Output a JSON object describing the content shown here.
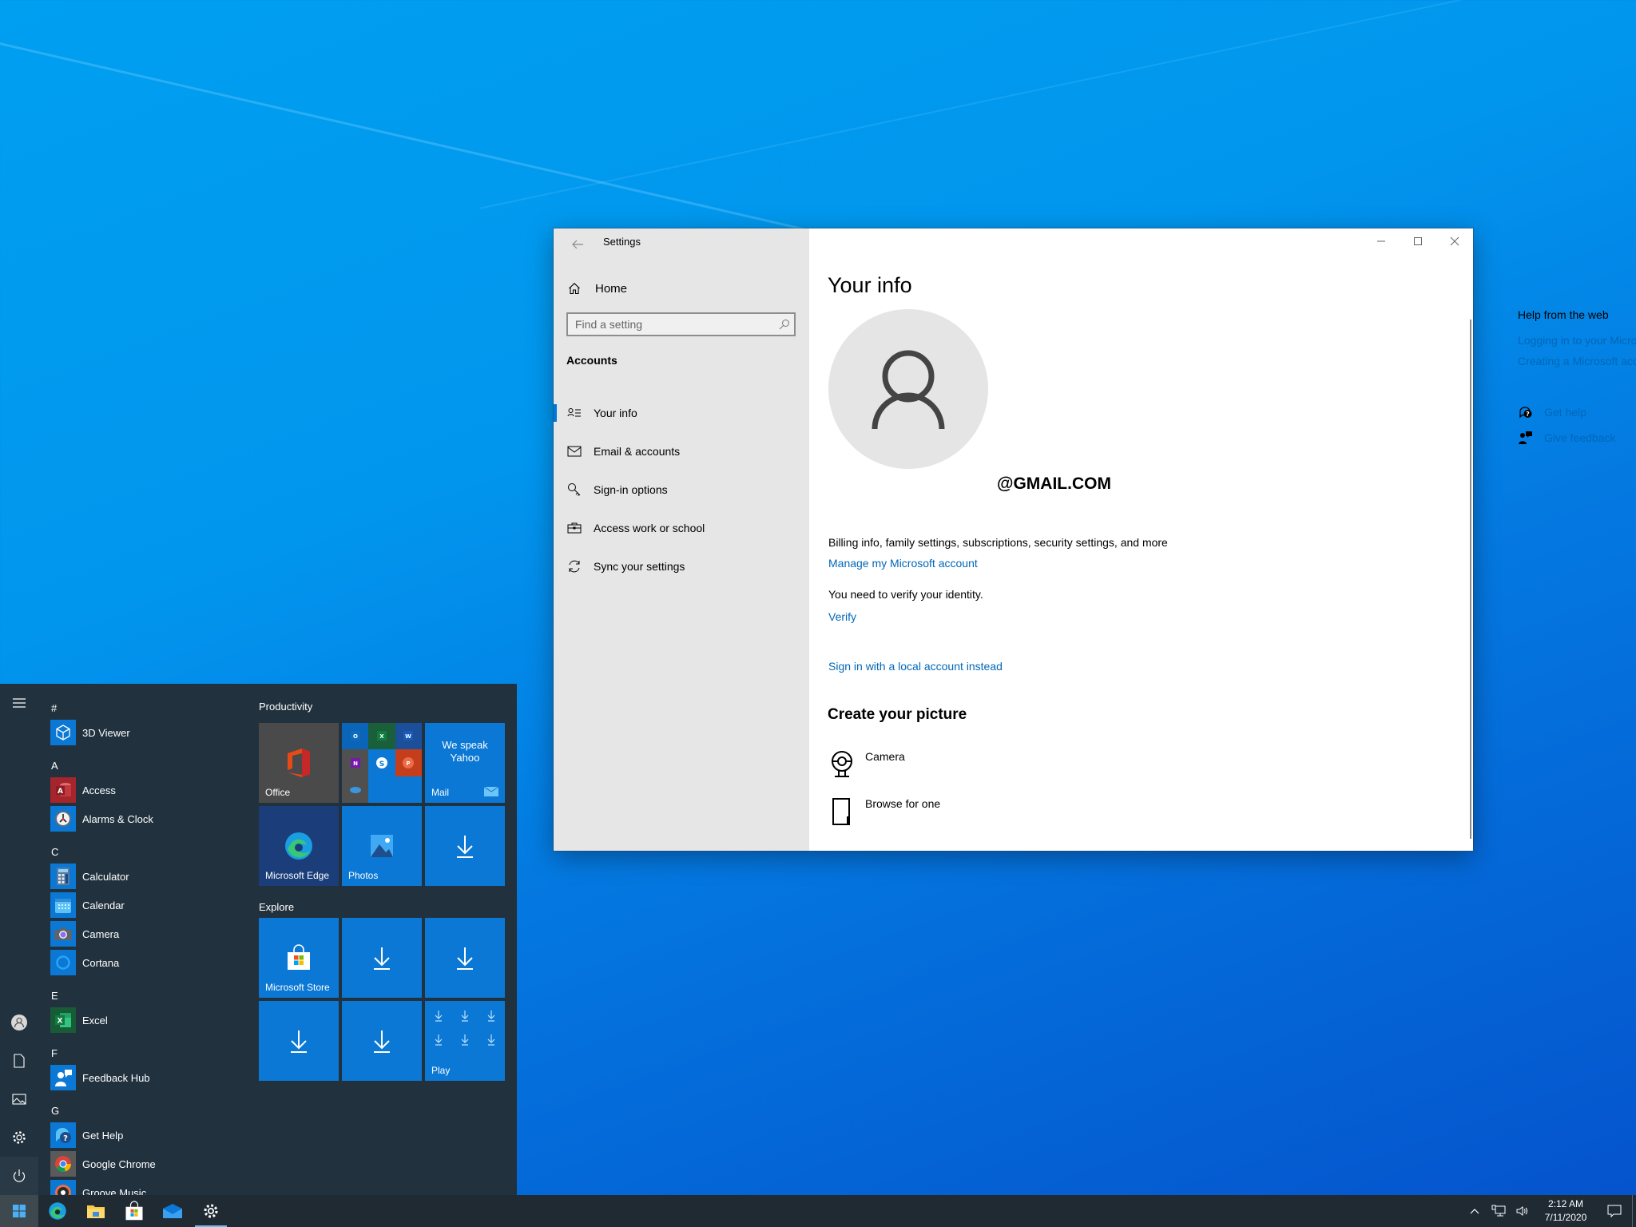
{
  "desktop": {
    "background_color": "#0196ee"
  },
  "settings_window": {
    "title": "Settings",
    "back_icon": "arrow-left-icon",
    "caption_buttons": {
      "minimize_icon": "minimize-icon",
      "maximize_icon": "maximize-icon",
      "close_icon": "close-icon"
    },
    "nav": {
      "home_label": "Home",
      "home_icon": "home-icon",
      "search": {
        "placeholder": "Find a setting",
        "value": "",
        "icon": "search-icon"
      },
      "section_title": "Accounts",
      "items": [
        {
          "label": "Your info",
          "icon": "person-list-icon",
          "active": true
        },
        {
          "label": "Email & accounts",
          "icon": "mail-icon",
          "active": false
        },
        {
          "label": "Sign-in options",
          "icon": "key-icon",
          "active": false
        },
        {
          "label": "Access work or school",
          "icon": "briefcase-icon",
          "active": false
        },
        {
          "label": "Sync your settings",
          "icon": "sync-icon",
          "active": false
        }
      ]
    },
    "content": {
      "title": "Your info",
      "avatar_icon": "person-icon",
      "email": "@GMAIL.COM",
      "billing_text": "Billing info, family settings, subscriptions, security settings, and more",
      "manage_link": "Manage my Microsoft account",
      "verify_text": "You need to verify your identity.",
      "verify_link": "Verify",
      "local_account_link": "Sign in with a local account instead",
      "create_picture_title": "Create your picture",
      "picture_options": [
        {
          "label": "Camera",
          "icon": "webcam-icon"
        },
        {
          "label": "Browse for one",
          "icon": "file-icon"
        }
      ]
    },
    "help": {
      "title": "Help from the web",
      "links": [
        "Logging in to your Microsoft account",
        "Creating a Microsoft account"
      ],
      "actions": [
        {
          "label": "Get help",
          "icon": "help-chat-icon"
        },
        {
          "label": "Give feedback",
          "icon": "feedback-icon"
        }
      ]
    },
    "accent_color": "#0078d7",
    "link_color": "#0067b8"
  },
  "start_menu": {
    "rail": [
      {
        "name": "hamburger-menu-icon"
      },
      {
        "name": "user-account-icon"
      },
      {
        "name": "documents-icon"
      },
      {
        "name": "pictures-icon"
      },
      {
        "name": "settings-gear-icon"
      },
      {
        "name": "power-icon"
      }
    ],
    "app_list": [
      {
        "letter": "#"
      },
      {
        "app": "3D Viewer",
        "icon": "cube-icon",
        "color": "#0a78d4"
      },
      {
        "letter": "A"
      },
      {
        "app": "Access",
        "icon": "access-icon",
        "color": "#a4262c"
      },
      {
        "app": "Alarms & Clock",
        "icon": "clock-icon",
        "color": "#0a78d4"
      },
      {
        "letter": "C"
      },
      {
        "app": "Calculator",
        "icon": "calculator-icon",
        "color": "#0a78d4"
      },
      {
        "app": "Calendar",
        "icon": "calendar-icon",
        "color": "#0a78d4"
      },
      {
        "app": "Camera",
        "icon": "camera-icon",
        "color": "#0a78d4"
      },
      {
        "app": "Cortana",
        "icon": "cortana-icon",
        "color": "#0a78d4"
      },
      {
        "letter": "E"
      },
      {
        "app": "Excel",
        "icon": "excel-icon",
        "color": "#107c41"
      },
      {
        "letter": "F"
      },
      {
        "app": "Feedback Hub",
        "icon": "feedback-hub-icon",
        "color": "#0a78d4"
      },
      {
        "letter": "G"
      },
      {
        "app": "Get Help",
        "icon": "get-help-icon",
        "color": "#0a78d4"
      },
      {
        "app": "Google Chrome",
        "icon": "chrome-icon",
        "color": "#5a5a5a"
      },
      {
        "app": "Groove Music",
        "icon": "groove-music-icon",
        "color": "#0a78d4"
      }
    ],
    "groups": [
      {
        "label": "Productivity",
        "tiles": [
          {
            "label": "Office",
            "icon": "office-icon",
            "color": "#4a4a4a"
          },
          {
            "label": "",
            "icon": "office-apps-folder-icon",
            "color": "#0a78d4"
          },
          {
            "label": "Mail",
            "icon": "mail-tile-icon",
            "text": "We speak Yahoo",
            "color": "#0a78d4"
          },
          {
            "label": "Microsoft Edge",
            "icon": "edge-icon",
            "color": "#1b3e7a"
          },
          {
            "label": "Photos",
            "icon": "photos-icon",
            "color": "#0a78d4"
          },
          {
            "label": "",
            "icon": "download-icon",
            "color": "#0a78d4"
          }
        ]
      },
      {
        "label": "Explore",
        "tiles": [
          {
            "label": "Microsoft Store",
            "icon": "store-icon",
            "color": "#0a78d4"
          },
          {
            "label": "",
            "icon": "download-icon",
            "color": "#0a78d4"
          },
          {
            "label": "",
            "icon": "download-icon",
            "color": "#0a78d4"
          },
          {
            "label": "",
            "icon": "download-icon",
            "color": "#0a78d4"
          },
          {
            "label": "",
            "icon": "download-icon",
            "color": "#0a78d4"
          },
          {
            "label": "Play",
            "icon": "download-grid-icon",
            "color": "#0a78d4"
          }
        ]
      }
    ]
  },
  "taskbar": {
    "buttons": [
      {
        "name": "start-button",
        "icon": "windows-logo-icon"
      },
      {
        "name": "edge-taskbar-button",
        "icon": "edge-icon"
      },
      {
        "name": "file-explorer-taskbar-button",
        "icon": "folder-icon"
      },
      {
        "name": "store-taskbar-button",
        "icon": "store-icon"
      },
      {
        "name": "mail-taskbar-button",
        "icon": "mail-icon"
      },
      {
        "name": "settings-taskbar-button",
        "icon": "gear-icon",
        "active": true
      }
    ],
    "tray": {
      "icons": [
        "chevron-up-icon",
        "network-icon",
        "volume-icon"
      ],
      "time": "2:12 AM",
      "date": "7/11/2020",
      "notification_icon": "action-center-icon"
    }
  }
}
